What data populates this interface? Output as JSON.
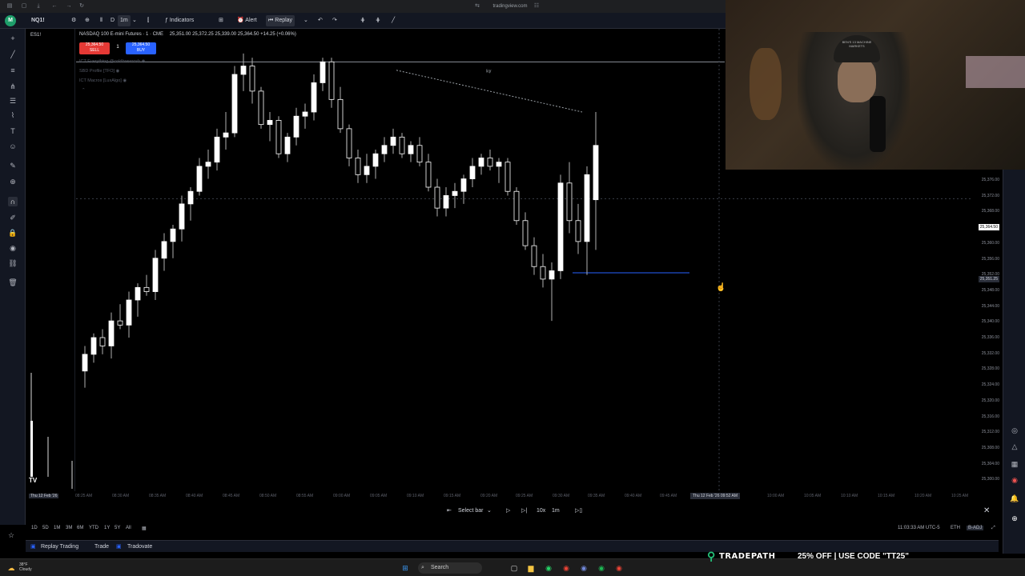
{
  "browser": {
    "url": "tradingview.com"
  },
  "toolbar": {
    "symbol": "NQ1!",
    "timeframes": [
      "D",
      "1m"
    ],
    "indicators_label": "Indicators",
    "alert_label": "Alert",
    "replay_label": "Replay"
  },
  "secondary_symbol": "ES1!",
  "legend": {
    "title": "NASDAQ 100 E-mini Futures · 1 · CME",
    "ohlc": "25,351.00  25,372.25  25,339.00  25,364.50  +14.25 (+0.06%)",
    "sell_price": "25,364.50",
    "sell_label": "SELL",
    "qty": "1",
    "buy_price": "25,364.50",
    "buy_label": "BUY",
    "indicators": [
      "ICT Everything @coldbrewrosh",
      "SBD Profile [TFO]",
      "ICT Macros [LuxAlgo]"
    ]
  },
  "trendline_label": "liqr",
  "price_axis": {
    "ticks": [
      "25,376.00",
      "25,372.00",
      "25,368.00",
      "25,364.00",
      "25,360.00",
      "25,356.00",
      "25,352.00",
      "25,348.00",
      "25,344.00",
      "25,340.00",
      "25,336.00",
      "25,332.00",
      "25,328.00",
      "25,324.00",
      "25,320.00",
      "25,316.00",
      "25,312.00",
      "25,308.00",
      "25,304.00",
      "25,300.00"
    ],
    "last_price": "25,364.50",
    "crosshair_price": "25,351.25"
  },
  "time_axis": {
    "left_date": "Thu 12 Feb '26",
    "ticks": [
      "08:25 AM",
      "08:30 AM",
      "08:35 AM",
      "08:40 AM",
      "08:45 AM",
      "08:50 AM",
      "08:55 AM",
      "09:00 AM",
      "09:05 AM",
      "09:10 AM",
      "09:15 AM",
      "09:20 AM",
      "09:25 AM",
      "09:30 AM",
      "09:35 AM",
      "09:40 AM",
      "09:45 AM",
      "09:52 AM",
      "10:00 AM",
      "10:05 AM",
      "10:10 AM",
      "10:15 AM",
      "10:20 AM",
      "10:25 AM"
    ],
    "crosshair_time": "Thu 12 Feb '26   09:52 AM"
  },
  "replay_bar": {
    "select_bar": "Select bar",
    "speed": "10x",
    "interval": "1m"
  },
  "range_bar": {
    "ranges": [
      "1D",
      "5D",
      "1M",
      "3M",
      "6M",
      "YTD",
      "1Y",
      "5Y",
      "All"
    ],
    "clock": "11:03:33 AM UTC-5",
    "session": "ETH",
    "adj": "B-ADJ"
  },
  "bottom_panel": {
    "tab1": "Replay Trading",
    "tab2": "Trade",
    "tab3": "Tradovate"
  },
  "taskbar": {
    "temp": "38°F",
    "weather": "Cloudy",
    "search": "Search"
  },
  "promo": {
    "brand": "TRADEPATH",
    "code_text": "25% OFF | USE CODE \"TT25\""
  },
  "webcam": {
    "cap_text": "BEN'S 13 MACHINE MARKETS"
  },
  "chart_data": {
    "type": "candlestick",
    "timeframe": "1m",
    "candles": [
      [
        25310,
        25316,
        25306,
        25314
      ],
      [
        25314,
        25319,
        25312,
        25318
      ],
      [
        25318,
        25320,
        25314,
        25316
      ],
      [
        25316,
        25324,
        25313,
        25322
      ],
      [
        25322,
        25326,
        25320,
        25321
      ],
      [
        25321,
        25329,
        25318,
        25327
      ],
      [
        25327,
        25331,
        25323,
        25330
      ],
      [
        25330,
        25333,
        25328,
        25329
      ],
      [
        25329,
        25339,
        25327,
        25337
      ],
      [
        25337,
        25343,
        25334,
        25341
      ],
      [
        25341,
        25345,
        25337,
        25344
      ],
      [
        25344,
        25352,
        25341,
        25350
      ],
      [
        25350,
        25354,
        25346,
        25353
      ],
      [
        25353,
        25361,
        25352,
        25359
      ],
      [
        25359,
        25363,
        25356,
        25360
      ],
      [
        25360,
        25368,
        25358,
        25366
      ],
      [
        25366,
        25372,
        25363,
        25367
      ],
      [
        25367,
        25383,
        25366,
        25381
      ],
      [
        25381,
        25386,
        25377,
        25383
      ],
      [
        25383,
        25385,
        25374,
        25377
      ],
      [
        25377,
        25378,
        25368,
        25369
      ],
      [
        25369,
        25372,
        25365,
        25370
      ],
      [
        25370,
        25371,
        25361,
        25362
      ],
      [
        25362,
        25367,
        25360,
        25366
      ],
      [
        25366,
        25373,
        25364,
        25371
      ],
      [
        25371,
        25374,
        25368,
        25372
      ],
      [
        25372,
        25381,
        25370,
        25379
      ],
      [
        25379,
        25385,
        25377,
        25384
      ],
      [
        25384,
        25385,
        25373,
        25375
      ],
      [
        25375,
        25378,
        25367,
        25368
      ],
      [
        25368,
        25369,
        25359,
        25361
      ],
      [
        25361,
        25363,
        25355,
        25357
      ],
      [
        25357,
        25362,
        25355,
        25359
      ],
      [
        25359,
        25363,
        25356,
        25362
      ],
      [
        25362,
        25366,
        25360,
        25364
      ],
      [
        25364,
        25368,
        25362,
        25366
      ],
      [
        25366,
        25367,
        25361,
        25362
      ],
      [
        25362,
        25365,
        25360,
        25364
      ],
      [
        25364,
        25366,
        25359,
        25360
      ],
      [
        25360,
        25362,
        25353,
        25354
      ],
      [
        25354,
        25356,
        25347,
        25349
      ],
      [
        25349,
        25354,
        25347,
        25352
      ],
      [
        25352,
        25355,
        25349,
        25353
      ],
      [
        25353,
        25357,
        25350,
        25356
      ],
      [
        25356,
        25361,
        25354,
        25359
      ],
      [
        25359,
        25362,
        25357,
        25361
      ],
      [
        25361,
        25363,
        25358,
        25359
      ],
      [
        25359,
        25361,
        25355,
        25360
      ],
      [
        25360,
        25361,
        25352,
        25353
      ],
      [
        25353,
        25354,
        25345,
        25346
      ],
      [
        25346,
        25348,
        25339,
        25340
      ],
      [
        25340,
        25342,
        25333,
        25335
      ],
      [
        25335,
        25338,
        25330,
        25332
      ],
      [
        25332,
        25336,
        25322,
        25334
      ],
      [
        25334,
        25357,
        25332,
        25355
      ],
      [
        25355,
        25360,
        25343,
        25346
      ],
      [
        25346,
        25350,
        25338,
        25341
      ],
      [
        25341,
        25359,
        25333,
        25357
      ],
      [
        25351,
        25372,
        25339,
        25364
      ]
    ],
    "horizontal_levels": [
      25384,
      25333.5
    ],
    "crosshair_price": 25351.25
  }
}
